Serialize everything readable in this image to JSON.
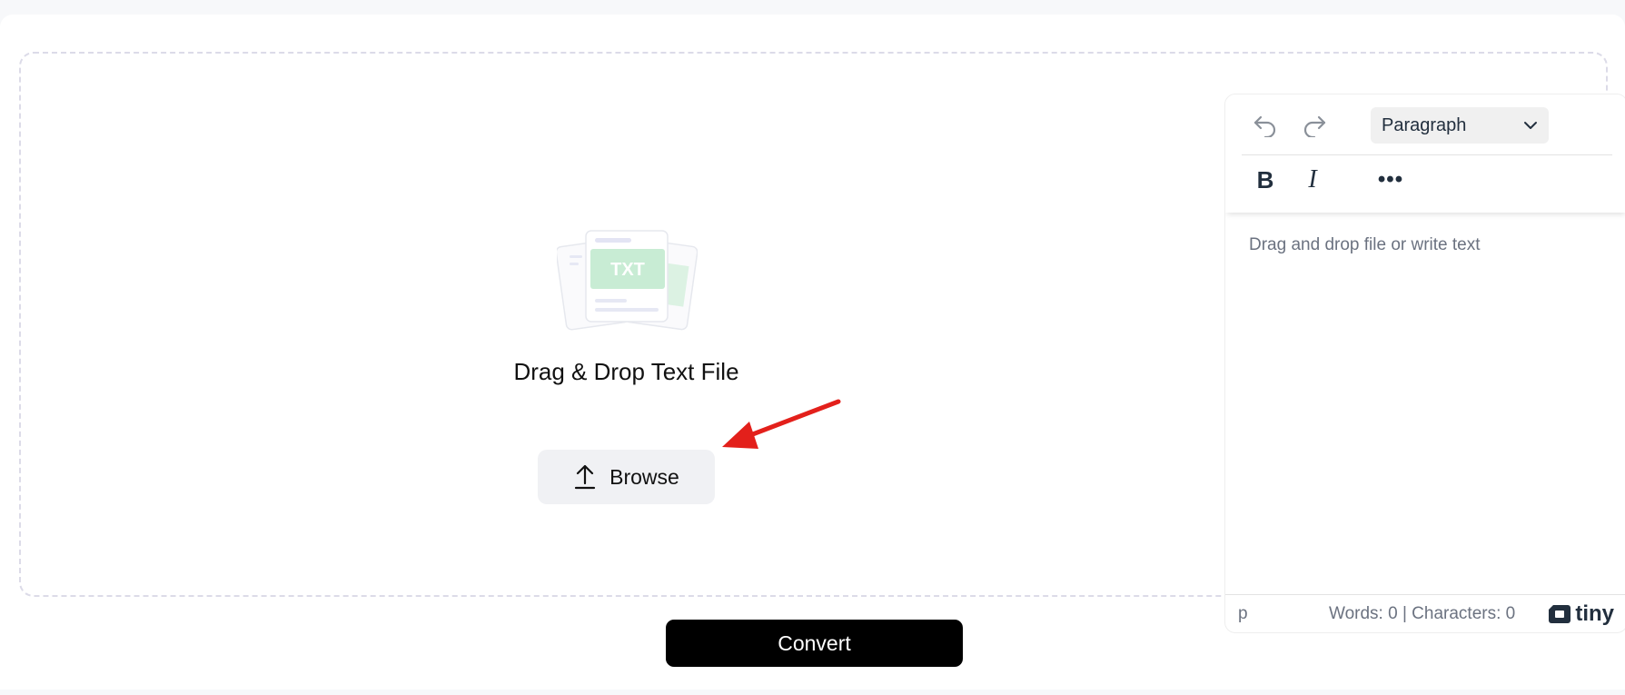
{
  "dropzone": {
    "illustration_label": "TXT",
    "title": "Drag & Drop Text File",
    "browse_label": "Browse"
  },
  "editor": {
    "format_select": "Paragraph",
    "bold_label": "B",
    "italic_label": "I",
    "more_label": "•••",
    "placeholder": "Drag and drop file or write text",
    "status_path": "p",
    "status_counts": "Words: 0 | Characters: 0",
    "brand": "tiny"
  },
  "actions": {
    "convert_label": "Convert"
  },
  "colors": {
    "annotation_arrow": "#e3201b",
    "convert_bg": "#000000",
    "illustration_green": "#c8ecd4"
  }
}
